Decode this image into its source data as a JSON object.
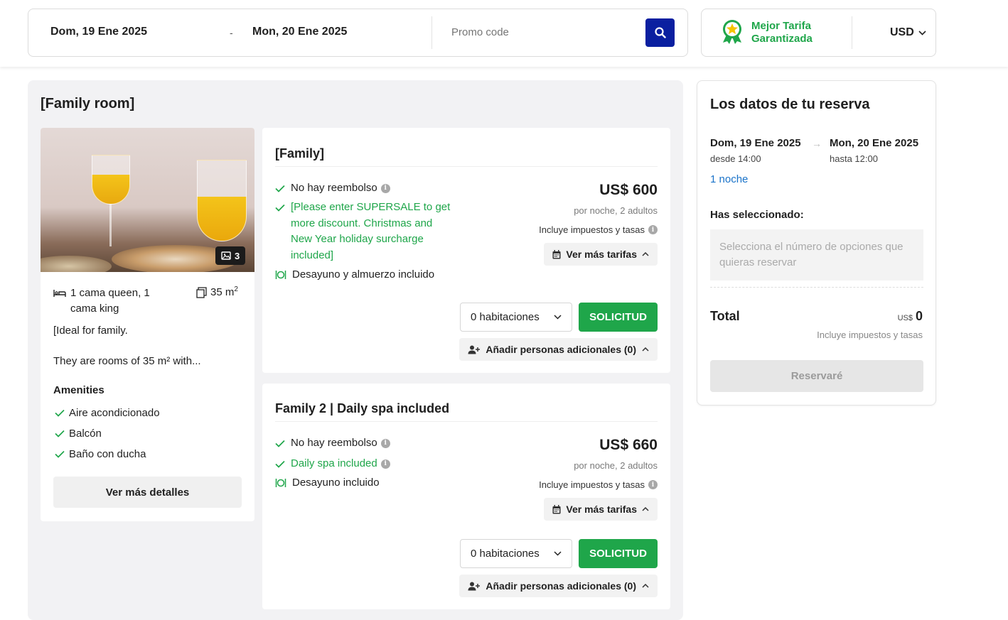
{
  "search": {
    "checkin": "Dom, 19 Ene 2025",
    "separator": "-",
    "checkout": "Mon, 20 Ene 2025",
    "promo_placeholder": "Promo code"
  },
  "badge": {
    "line1": "Mejor Tarifa",
    "line2": "Garantizada"
  },
  "currency": "USD",
  "room": {
    "title": "[Family room]",
    "photo_count": "3",
    "beds_line1": "1 cama queen, 1",
    "beds_line2": "cama king",
    "size": "35 m",
    "size_sup": "2",
    "desc1": "[Ideal for family.",
    "desc2": "They are rooms of 35 m² with...",
    "amenities_title": "Amenities",
    "amenities": [
      "Aire acondicionado",
      "Balcón",
      "Baño con ducha"
    ],
    "details_button": "Ver más detalles"
  },
  "rates": [
    {
      "title": "[Family]",
      "refund": "No hay reembolso",
      "promo_l1": "[Please enter SUPERSALE to get",
      "promo_l2": "more discount. Christmas and",
      "promo_l3": "New Year holiday surcharge",
      "promo_l4": "included]",
      "meal": "Desayuno y almuerzo incluido",
      "price": "US$ 600",
      "per_night": "por noche, 2 adultos",
      "taxes": "Incluye impuestos y tasas",
      "more_rates": "Ver más tarifas",
      "rooms_select": "0 habitaciones",
      "request": "SOLICITUD",
      "add_people": "Añadir personas adicionales (0)"
    },
    {
      "title": "Family 2 | Daily spa included",
      "refund": "No hay reembolso",
      "spa": "Daily spa included",
      "meal": "Desayuno incluido",
      "price": "US$ 660",
      "per_night": "por noche, 2 adultos",
      "taxes": "Incluye impuestos y tasas",
      "more_rates": "Ver más tarifas",
      "rooms_select": "0 habitaciones",
      "request": "SOLICITUD",
      "add_people": "Añadir personas adicionales (0)"
    }
  ],
  "summary": {
    "title": "Los datos de tu reserva",
    "checkin": "Dom, 19 Ene 2025",
    "checkin_time": "desde 14:00",
    "checkout": "Mon, 20 Ene 2025",
    "checkout_time": "hasta 12:00",
    "nights": "1 noche",
    "selected_label": "Has seleccionado:",
    "selected_placeholder": "Selecciona el número de opciones que quieras reservar",
    "total_label": "Total",
    "total_currency": "US$",
    "total_value": "0",
    "taxes": "Incluye impuestos y tasas",
    "book_button": "Reservaré"
  },
  "colors": {
    "brand_blue": "#0a1fa0",
    "accent_green": "#1fa64a",
    "link_blue": "#1a73c9"
  }
}
